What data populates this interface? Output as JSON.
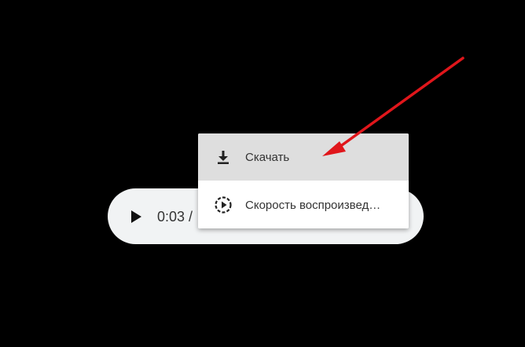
{
  "player": {
    "time_text": "0:03 /"
  },
  "menu": {
    "items": [
      {
        "label": "Скачать",
        "icon": "download-icon",
        "highlighted": true
      },
      {
        "label": "Скорость воспроизвед…",
        "icon": "playback-speed-icon",
        "highlighted": false
      }
    ]
  },
  "colors": {
    "background": "#000000",
    "player_bg": "#f1f3f4",
    "menu_bg": "#ffffff",
    "menu_highlight": "#dedede",
    "annotation_arrow": "#e0161b"
  }
}
